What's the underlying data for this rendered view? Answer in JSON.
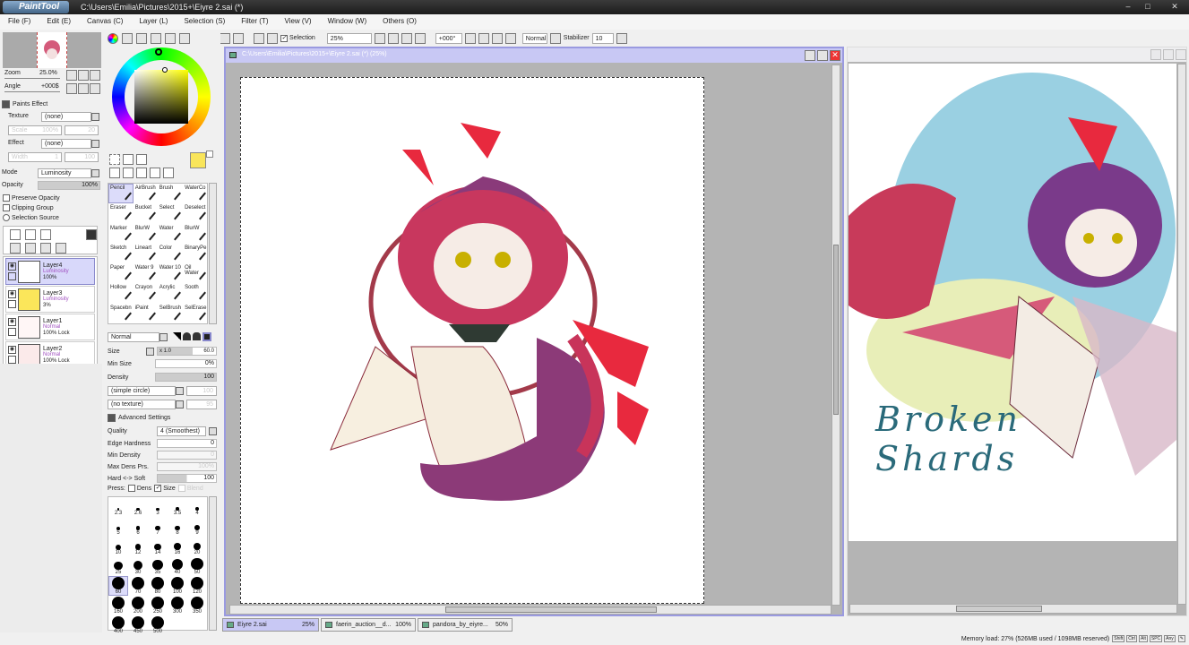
{
  "app": {
    "logo": "PaintTool SAI",
    "title": "C:\\Users\\Emilia\\Pictures\\2015+\\Eiyre 2.sai (*)"
  },
  "menu": [
    "File (F)",
    "Edit (E)",
    "Canvas (C)",
    "Layer (L)",
    "Selection (S)",
    "Filter (T)",
    "View (V)",
    "Window (W)",
    "Others (O)"
  ],
  "toolbar": {
    "selection_label": "Selection",
    "zoom": "25%",
    "angle": "+000°",
    "mode": "Normal",
    "stabilizer_label": "Stabilizer",
    "stabilizer": "10"
  },
  "navigator": {
    "zoom_label": "Zoom",
    "zoom": "25.0%",
    "angle_label": "Angle",
    "angle": "+000$"
  },
  "paints_effect": {
    "title": "Paints Effect",
    "texture_label": "Texture",
    "texture": "(none)",
    "scale_label": "Scale",
    "scale": "100%",
    "scale2": "20",
    "effect_label": "Effect",
    "effect": "(none)",
    "width_label": "Width",
    "width": "1",
    "width2": "100"
  },
  "layer_props": {
    "mode_label": "Mode",
    "mode": "Luminosity",
    "opacity_label": "Opacity",
    "opacity": "100%",
    "preserve": "Preserve Opacity",
    "clipping": "Clipping Group",
    "selsource": "Selection Source"
  },
  "layers": [
    {
      "name": "Layer4",
      "mode": "Luminosity",
      "opacity": "100%",
      "color": "#ffffff",
      "selected": true
    },
    {
      "name": "Layer3",
      "mode": "Luminosity",
      "opacity": "3%",
      "color": "#fbe65a",
      "selected": false
    },
    {
      "name": "Layer1",
      "mode": "Normal",
      "opacity": "100% Lock",
      "color": "#fff6f6",
      "selected": false
    },
    {
      "name": "Layer2",
      "mode": "Normal",
      "opacity": "100% Lock",
      "color": "#fbeaea",
      "selected": false
    }
  ],
  "tools": [
    "Pencil",
    "AirBrush",
    "Brush",
    "WaterCo",
    "Eraser",
    "Bucket",
    "Select",
    "Deselect",
    "Marker",
    "BlurW",
    "Water",
    "BlurW",
    "Sketch",
    "Lineart",
    "Color",
    "BinaryPe",
    "Paper",
    "Water 9",
    "Water 10",
    "Oil Water",
    "Hollow",
    "Crayon",
    "Acrylic",
    "Sooth",
    "Spacebn",
    "iPaint",
    "SelBrush",
    "SelErase"
  ],
  "brush": {
    "blend": "Normal",
    "size_label": "Size",
    "size_mult": "x 1.0",
    "size": "60.0",
    "minsize_label": "Min Size",
    "minsize": "0%",
    "density_label": "Density",
    "density": "100",
    "shape": "(simple circle)",
    "shape_val": "100",
    "texture": "(no texture)",
    "texture_val": "95",
    "advanced": "Advanced Settings",
    "quality_label": "Quality",
    "quality": "4 (Smoothest)",
    "edge_label": "Edge Hardness",
    "edge": "0",
    "mindens_label": "Min Density",
    "mindens": "0",
    "maxdens_label": "Max Dens Prs.",
    "maxdens": "100%",
    "hardsoft_label": "Hard <-> Soft",
    "hardsoft": "100",
    "press_label": "Press:",
    "press_dens": "Dens",
    "press_size": "Size",
    "press_blend": "Blend"
  },
  "brush_sizes": [
    "2.3",
    "2.6",
    "3",
    "3.5",
    "4",
    "5",
    "6",
    "7",
    "8",
    "9",
    "10",
    "12",
    "14",
    "16",
    "20",
    "25",
    "30",
    "35",
    "40",
    "50",
    "60",
    "70",
    "80",
    "100",
    "120",
    "160",
    "200",
    "250",
    "300",
    "350",
    "400",
    "450",
    "500"
  ],
  "selected_size": "60",
  "canvas": {
    "title": "C:\\Users\\Emilia\\Pictures\\2015+\\Eiyre 2.sai (*) (25%)"
  },
  "reference": {
    "text": "Broken Shards"
  },
  "tabs": [
    {
      "name": "Eiyre 2.sai",
      "zoom": "25%"
    },
    {
      "name": "faerin_auction__d...",
      "zoom": "100%"
    },
    {
      "name": "pandora_by_eiyre...",
      "zoom": "50%"
    }
  ],
  "status": {
    "memory": "Memory load: 27% (526MB used / 1098MB reserved)",
    "keys": [
      "Shift",
      "Ctrl",
      "Alt",
      "SPC",
      "Any"
    ]
  }
}
